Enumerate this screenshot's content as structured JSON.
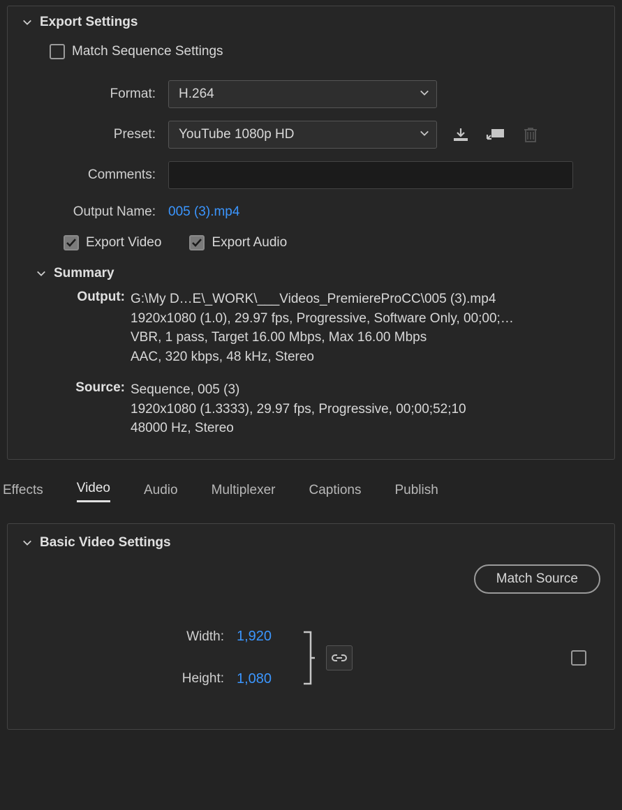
{
  "exportSettings": {
    "title": "Export Settings",
    "matchSequence": {
      "label": "Match Sequence Settings"
    },
    "format": {
      "label": "Format:",
      "value": "H.264"
    },
    "preset": {
      "label": "Preset:",
      "value": "YouTube 1080p HD"
    },
    "comments": {
      "label": "Comments:",
      "value": ""
    },
    "outputName": {
      "label": "Output Name:",
      "value": "005 (3).mp4"
    },
    "exportVideo": {
      "label": "Export Video"
    },
    "exportAudio": {
      "label": "Export Audio"
    },
    "summary": {
      "title": "Summary",
      "output": {
        "label": "Output:",
        "path": "G:\\My D…E\\_WORK\\___Videos_PremiereProCC\\005 (3).mp4",
        "video": "1920x1080 (1.0), 29.97 fps, Progressive, Software Only, 00;00;…",
        "bitrate": "VBR, 1 pass, Target 16.00 Mbps, Max 16.00 Mbps",
        "audio": "AAC, 320 kbps, 48 kHz, Stereo"
      },
      "source": {
        "label": "Source:",
        "name": "Sequence, 005 (3)",
        "video": "1920x1080 (1.3333), 29.97 fps, Progressive, 00;00;52;10",
        "audio": "48000 Hz, Stereo"
      }
    }
  },
  "tabs": {
    "effects": "Effects",
    "video": "Video",
    "audio": "Audio",
    "multiplexer": "Multiplexer",
    "captions": "Captions",
    "publish": "Publish"
  },
  "basicVideo": {
    "title": "Basic Video Settings",
    "matchSource": "Match Source",
    "width": {
      "label": "Width:",
      "value": "1,920"
    },
    "height": {
      "label": "Height:",
      "value": "1,080"
    }
  }
}
